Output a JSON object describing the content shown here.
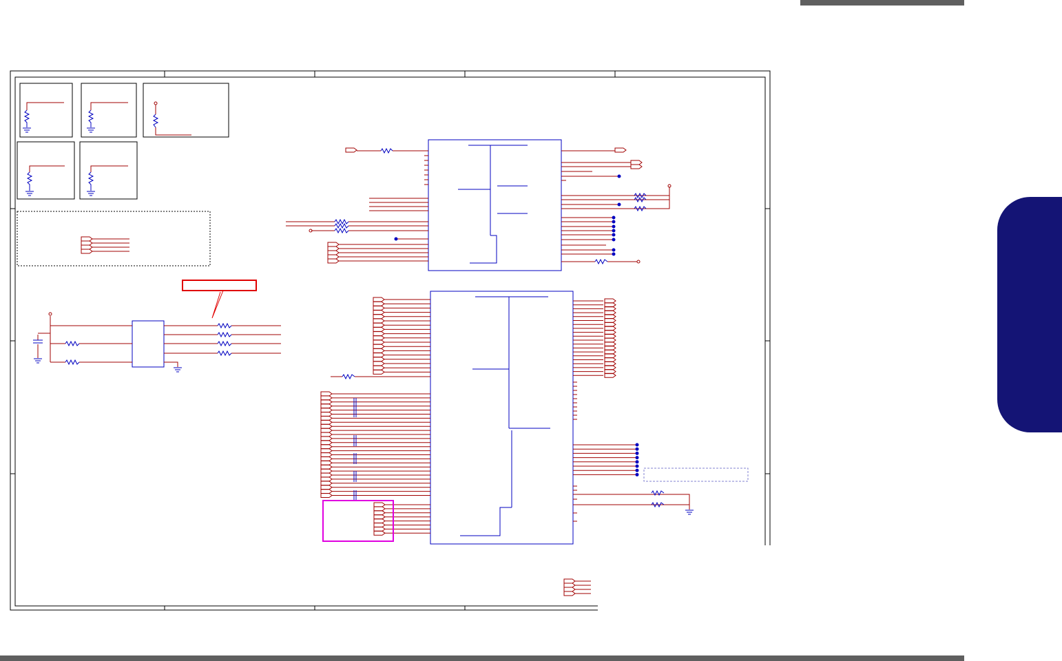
{
  "page": {
    "header_bar": "",
    "footer_bar": "",
    "chapter_tab": ""
  },
  "colors": {
    "wire": "#a00000",
    "component": "#0000c0",
    "frame": "#000000",
    "callout": "#e00000",
    "highlight": "#e000e0",
    "tab": "#141475",
    "bar": "#5f5f5f"
  },
  "schematic": {
    "title_block": ""
  }
}
